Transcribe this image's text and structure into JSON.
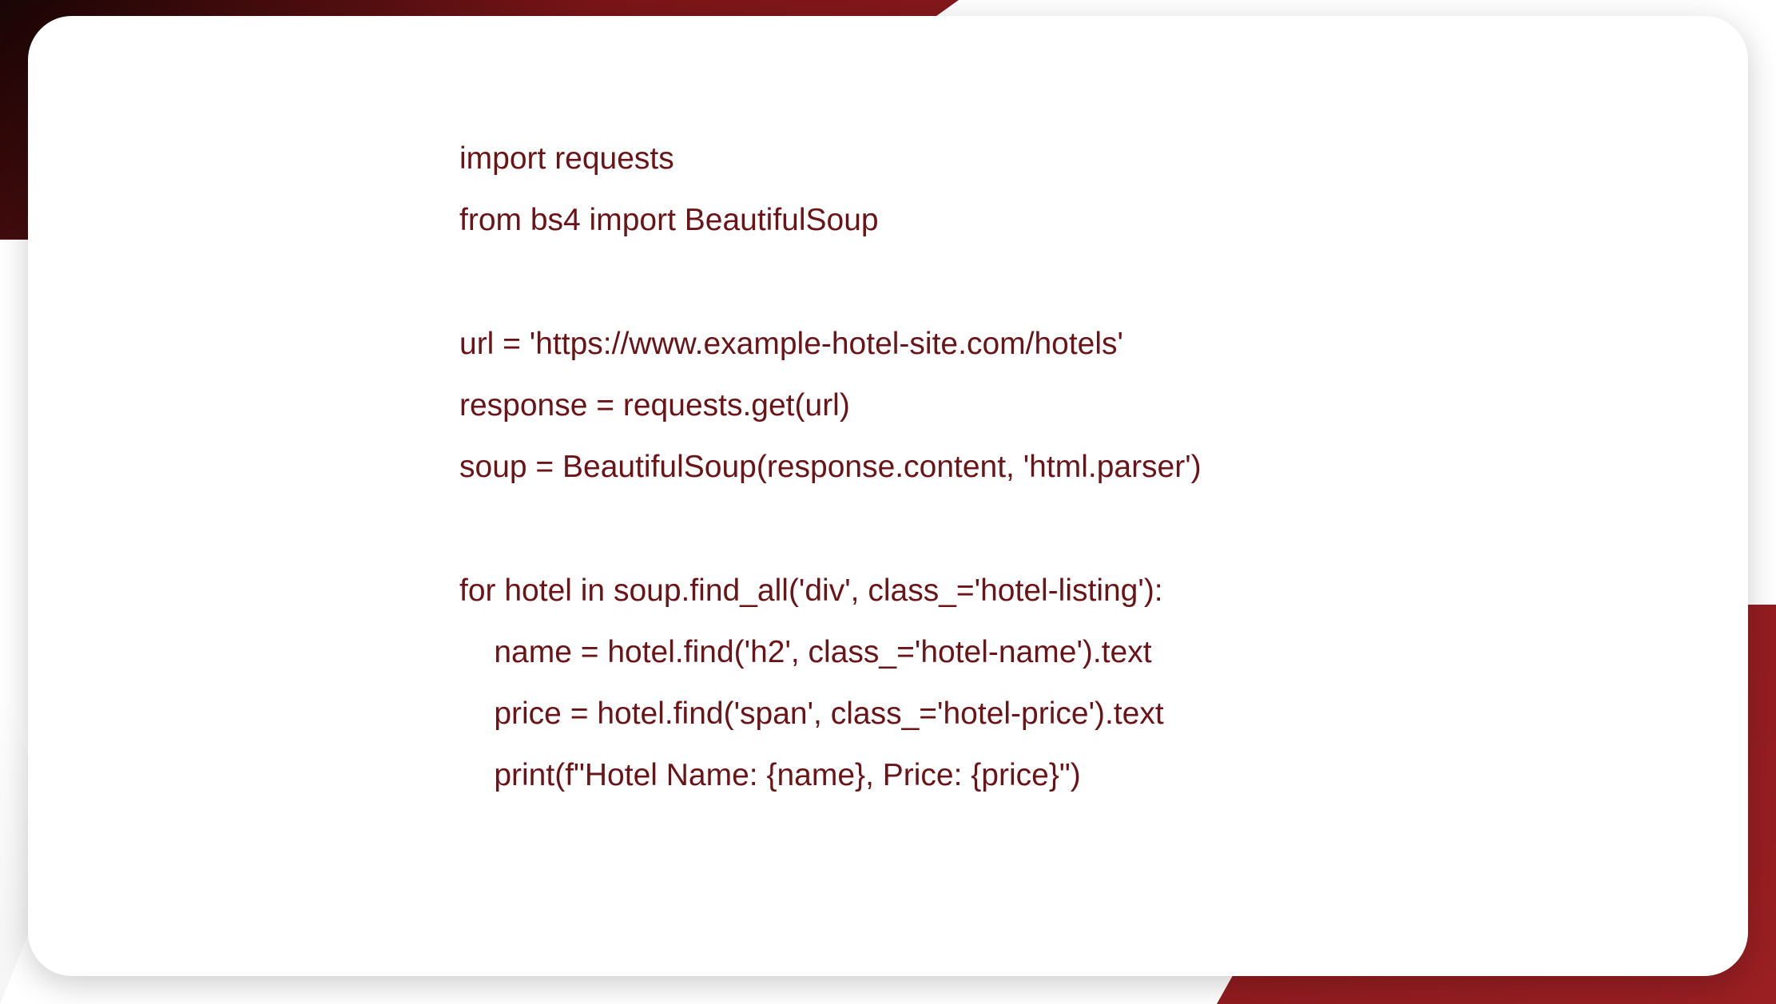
{
  "code": {
    "line1": "import requests",
    "line2": "from bs4 import BeautifulSoup",
    "line3": "",
    "line4": "url = 'https://www.example-hotel-site.com/hotels'",
    "line5": "response = requests.get(url)",
    "line6": "soup = BeautifulSoup(response.content, 'html.parser')",
    "line7": "",
    "line8": "for hotel in soup.find_all('div', class_='hotel-listing'):",
    "line9": "    name = hotel.find('h2', class_='hotel-name').text",
    "line10": "    price = hotel.find('span', class_='hotel-price').text",
    "line11": "    print(f\"Hotel Name: {name}, Price: {price}\")"
  },
  "colors": {
    "text": "#6b1418",
    "background": "#ffffff",
    "accent_dark": "#1a0505",
    "accent_red": "#8a1a1d"
  }
}
